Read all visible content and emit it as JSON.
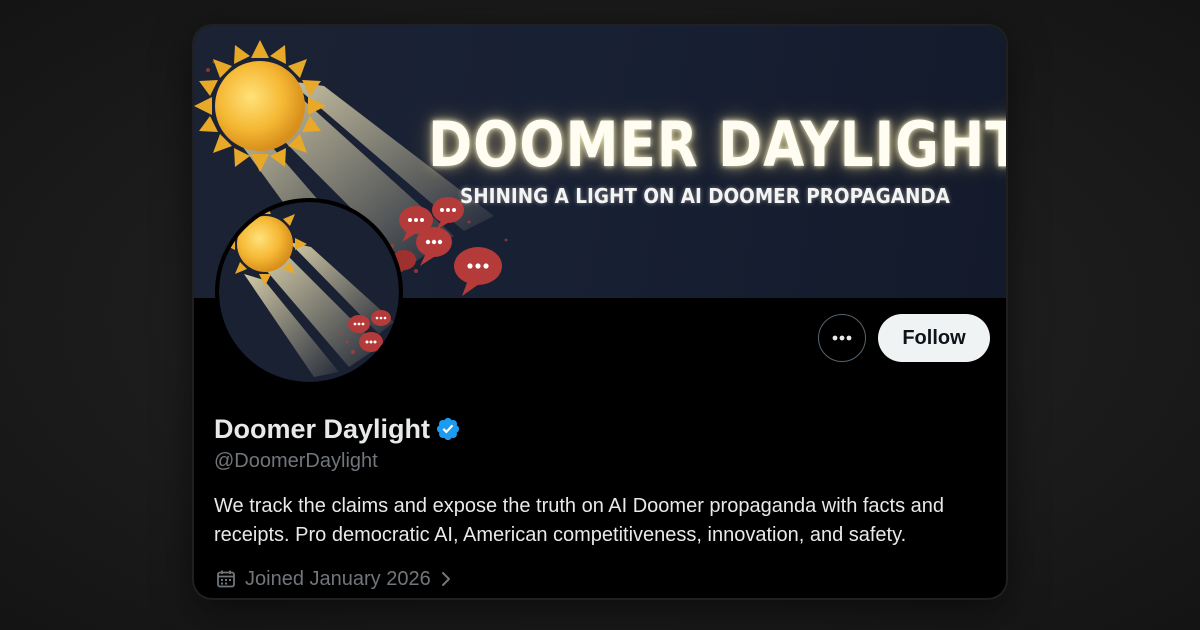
{
  "banner": {
    "title": "DOOMER DAYLIGHT",
    "subtitle": "SHINING A LIGHT ON AI DOOMER PROPAGANDA"
  },
  "actions": {
    "more_icon": "more-horizontal-icon",
    "follow_label": "Follow"
  },
  "profile": {
    "display_name": "Doomer Daylight",
    "verified_icon": "verified-badge-icon",
    "handle": "@DoomerDaylight",
    "bio": "We track the claims and expose the truth on AI Doomer propaganda with facts and receipts. Pro democratic AI, American competitiveness, innovation, and safety.",
    "joined_icon": "calendar-icon",
    "joined": "Joined January 2026"
  },
  "colors": {
    "background": "#000000",
    "text_primary": "#e7e9ea",
    "text_secondary": "#71767b",
    "verified_blue": "#1d9bf0",
    "follow_bg": "#eff3f4",
    "banner_bg": "#1b2233",
    "sun": "#f2b632",
    "speech_bubble": "#b53a3a"
  }
}
